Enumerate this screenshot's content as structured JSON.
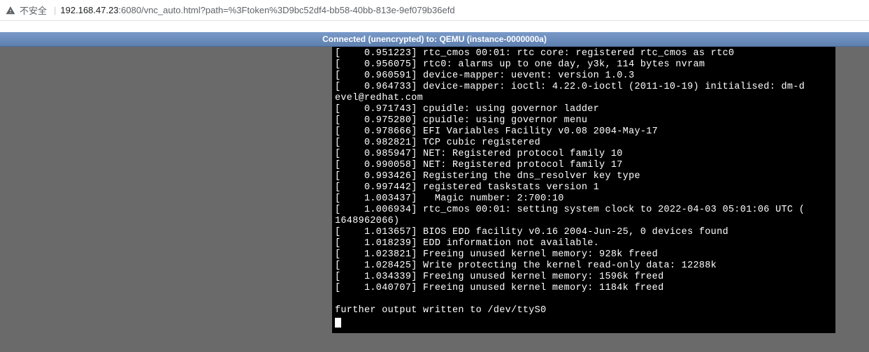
{
  "browser": {
    "security_label": "不安全",
    "url_host": "192.168.47.23",
    "url_port": ":6080",
    "url_path": "/vnc_auto.html?path=%3Ftoken%3D9bc52df4-bb58-40bb-813e-9ef079b36efd"
  },
  "vnc": {
    "status": "Connected (unencrypted) to: QEMU (instance-0000000a)"
  },
  "terminal": {
    "lines": [
      "[    0.951223] rtc_cmos 00:01: rtc core: registered rtc_cmos as rtc0",
      "[    0.956075] rtc0: alarms up to one day, y3k, 114 bytes nvram",
      "[    0.960591] device-mapper: uevent: version 1.0.3",
      "[    0.964733] device-mapper: ioctl: 4.22.0-ioctl (2011-10-19) initialised: dm-d",
      "evel@redhat.com",
      "[    0.971743] cpuidle: using governor ladder",
      "[    0.975280] cpuidle: using governor menu",
      "[    0.978666] EFI Variables Facility v0.08 2004-May-17",
      "[    0.982821] TCP cubic registered",
      "[    0.985947] NET: Registered protocol family 10",
      "[    0.990058] NET: Registered protocol family 17",
      "[    0.993426] Registering the dns_resolver key type",
      "[    0.997442] registered taskstats version 1",
      "[    1.003437]   Magic number: 2:700:10",
      "[    1.006934] rtc_cmos 00:01: setting system clock to 2022-04-03 05:01:06 UTC (",
      "1648962066)",
      "[    1.013657] BIOS EDD facility v0.16 2004-Jun-25, 0 devices found",
      "[    1.018239] EDD information not available.",
      "[    1.023821] Freeing unused kernel memory: 928k freed",
      "[    1.028425] Write protecting the kernel read-only data: 12288k",
      "[    1.034339] Freeing unused kernel memory: 1596k freed",
      "[    1.040707] Freeing unused kernel memory: 1184k freed",
      "",
      "further output written to /dev/ttyS0"
    ]
  }
}
